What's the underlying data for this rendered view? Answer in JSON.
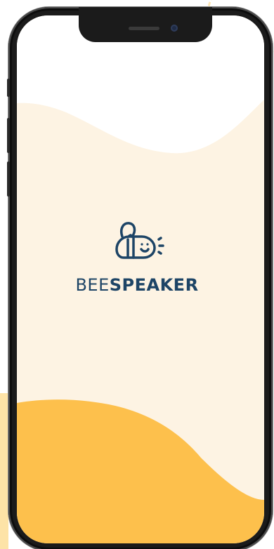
{
  "app": {
    "brand_light": "BEE",
    "brand_bold": "SPEAKER"
  },
  "icons": {
    "logo": "bee-icon"
  },
  "colors": {
    "background_cream": "#fdf3e3",
    "wave_white": "#ffffff",
    "wave_yellow": "#fdc04c",
    "brand_navy": "#1d4466",
    "frame_dark": "#1b1b1b"
  }
}
